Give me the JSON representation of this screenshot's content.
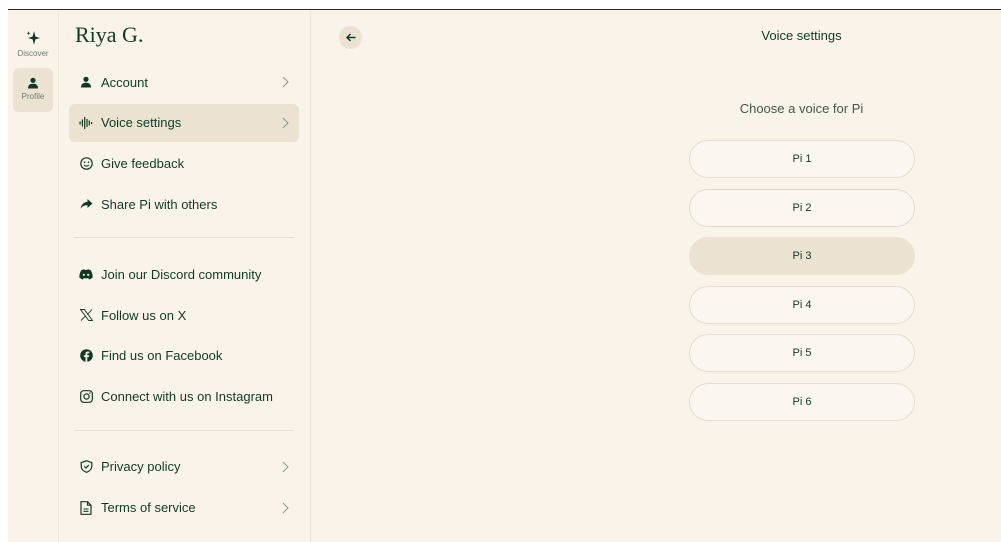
{
  "rail": {
    "discover_label": "Discover",
    "profile_label": "Profile"
  },
  "sidebar": {
    "user_name": "Riya G.",
    "primary_items": [
      {
        "label": "Account",
        "icon": "user-icon",
        "chevron": true
      },
      {
        "label": "Voice settings",
        "icon": "waveform-icon",
        "chevron": true,
        "active": true
      },
      {
        "label": "Give feedback",
        "icon": "smiley-icon",
        "chevron": false
      },
      {
        "label": "Share Pi with others",
        "icon": "share-arrow-icon",
        "chevron": false
      }
    ],
    "social_items": [
      {
        "label": "Join our Discord community",
        "icon": "discord-icon"
      },
      {
        "label": "Follow us on X",
        "icon": "x-icon"
      },
      {
        "label": "Find us on Facebook",
        "icon": "facebook-icon"
      },
      {
        "label": "Connect with us on Instagram",
        "icon": "instagram-icon"
      }
    ],
    "legal_items": [
      {
        "label": "Privacy policy",
        "icon": "shield-icon",
        "chevron": true
      },
      {
        "label": "Terms of service",
        "icon": "document-icon",
        "chevron": true
      }
    ]
  },
  "main": {
    "title": "Voice settings",
    "subtitle": "Choose a voice for Pi",
    "back_icon": "back-arrow-icon",
    "voices": [
      {
        "label": "Pi 1",
        "selected": false
      },
      {
        "label": "Pi 2",
        "selected": false
      },
      {
        "label": "Pi 3",
        "selected": true
      },
      {
        "label": "Pi 4",
        "selected": false
      },
      {
        "label": "Pi 5",
        "selected": false
      },
      {
        "label": "Pi 6",
        "selected": false
      }
    ]
  },
  "colors": {
    "background": "#faf3ea",
    "accent": "#ece2d2",
    "text": "#0d3c26"
  }
}
